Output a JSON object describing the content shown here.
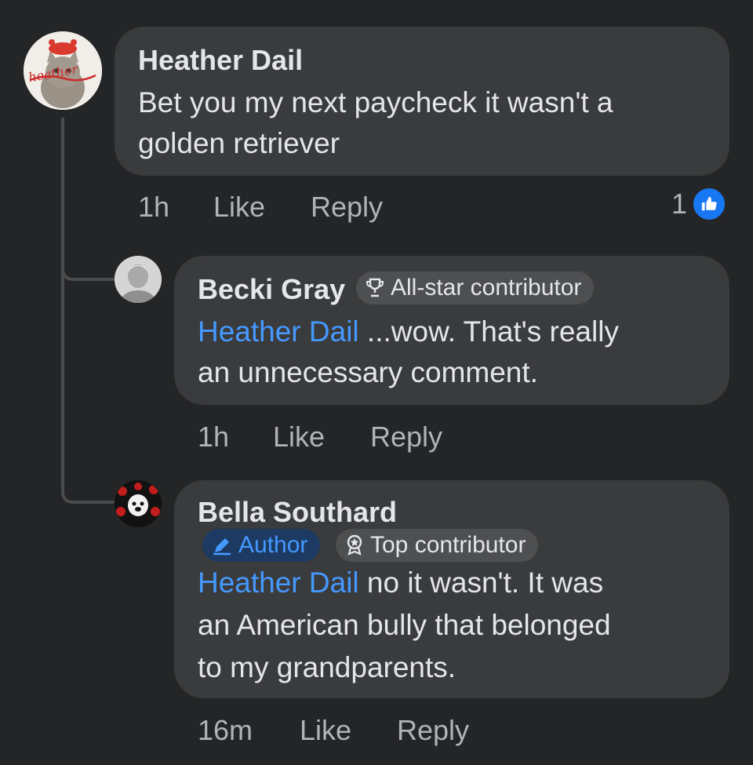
{
  "comments": [
    {
      "author": "Heather Dail",
      "text_line1": "Bet you my next paycheck it wasn't a",
      "text_line2": "golden retriever",
      "time": "1h",
      "like_label": "Like",
      "reply_label": "Reply",
      "reaction_count": "1",
      "reaction_icon": "thumbs-up-icon",
      "avatar_text": "heather"
    },
    {
      "author": "Becki Gray",
      "badge": "All-star contributor",
      "badge_icon": "trophy-icon",
      "mention": "Heather Dail",
      "text_line1_rest": " ...wow. That's really",
      "text_line2": "an unnecessary comment.",
      "time": "1h",
      "like_label": "Like",
      "reply_label": "Reply"
    },
    {
      "author": "Bella Southard",
      "badge_author": "Author",
      "badge_author_icon": "pencil-icon",
      "badge_top": "Top contributor",
      "badge_top_icon": "medal-icon",
      "mention": "Heather Dail",
      "text_line1_rest": " no it wasn't. It was",
      "text_line2": "an American bully that belonged",
      "text_line3": "to my grandparents.",
      "time": "16m",
      "like_label": "Like",
      "reply_label": "Reply"
    }
  ],
  "colors": {
    "background": "#242526",
    "bubble": "#3a3b3c",
    "text": "#e4e6eb",
    "muted": "#b0b3b8",
    "mention": "#4599ff",
    "like_blue": "#1877f2"
  }
}
